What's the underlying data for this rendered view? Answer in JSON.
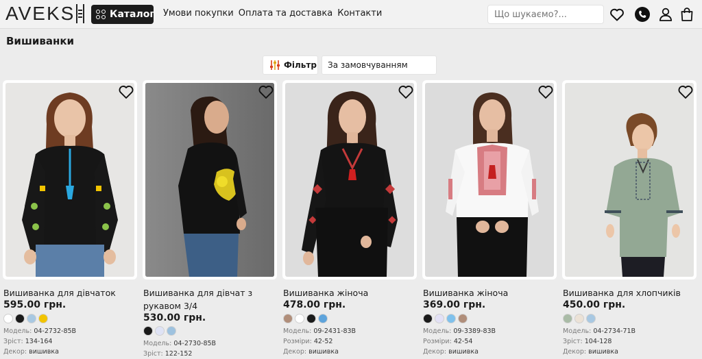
{
  "header": {
    "logo": "AVEKS",
    "catalog_label": "Каталог",
    "nav": [
      "Умови покупки",
      "Оплата та доставка",
      "Контакти"
    ],
    "search_placeholder": "Що шукаємо?..."
  },
  "page": {
    "title": "Вишиванки",
    "filter_label": "Фільтр",
    "sort_value": "За замовчуванням"
  },
  "labels": {
    "model": "Модель:",
    "height": "Зріст:",
    "sizes": "Розміри:",
    "decor": "Декор:"
  },
  "products": [
    {
      "name": "Вишиванка для дівчаток",
      "price": "595.00 грн.",
      "swatches": [
        "#ffffff",
        "#1a1a1a",
        "#a8c8e2",
        "#f2c400"
      ],
      "model": "04-2732-85В",
      "size_label": "Зріст:",
      "size": "134-164",
      "decor": "вишивка"
    },
    {
      "name": "Вишиванка для дівчат з рукавом 3/4",
      "price": "530.00 грн.",
      "swatches": [
        "#1a1a1a",
        "#dfe3f5",
        "#9ec2df"
      ],
      "model": "04-2730-85В",
      "size_label": "Зріст:",
      "size": "122-152",
      "decor": ""
    },
    {
      "name": "Вишиванка жіноча",
      "price": "478.00 грн.",
      "swatches": [
        "#b08e7a",
        "#ffffff",
        "#1a1a1a",
        "#5ea4dc"
      ],
      "model": "09-2431-83В",
      "size_label": "Розміри:",
      "size": "42-52",
      "decor": "вишивка"
    },
    {
      "name": "Вишиванка жіноча",
      "price": "369.00 грн.",
      "swatches": [
        "#1a1a1a",
        "#e3e1f6",
        "#7fc1ec",
        "#b08e7a"
      ],
      "model": "09-3389-83В",
      "size_label": "Розміри:",
      "size": "42-54",
      "decor": "вишивка"
    },
    {
      "name": "Вишиванка для хлопчиків",
      "price": "450.00 грн.",
      "swatches": [
        "#a9bba6",
        "#ece2d6",
        "#a8c8e2"
      ],
      "model": "04-2734-71В",
      "size_label": "Зріст:",
      "size": "104-128",
      "decor": "вишивка"
    }
  ]
}
